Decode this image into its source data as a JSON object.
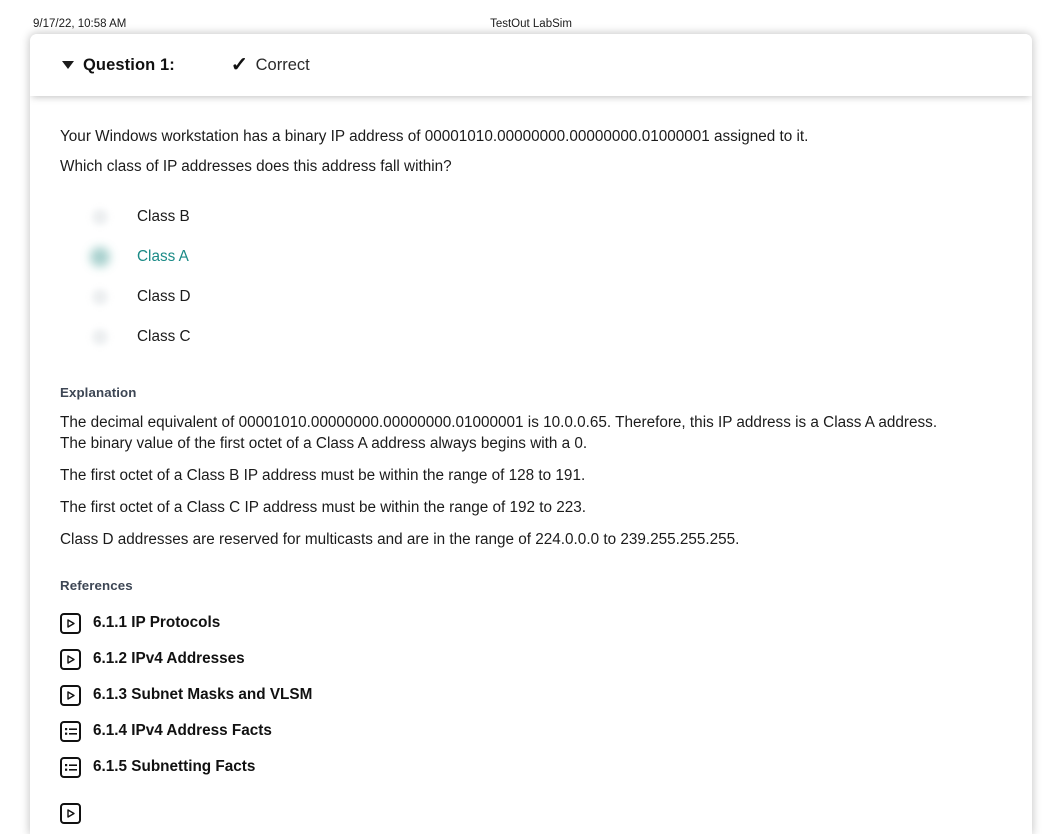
{
  "print_header": {
    "date": "9/17/22, 10:58 AM",
    "title": "TestOut LabSim"
  },
  "question": {
    "caret_icon": "caret-down-icon",
    "label": "Question 1:",
    "status_icon": "check-icon",
    "status_text": "Correct",
    "stem_line_1": "Your Windows workstation has a binary IP address of 00001010.00000000.00000000.01000001 assigned to it.",
    "stem_line_2": "Which class of IP addresses does this address fall within?",
    "options": [
      {
        "label": "Class B",
        "selected": false
      },
      {
        "label": "Class A",
        "selected": true
      },
      {
        "label": "Class D",
        "selected": false
      },
      {
        "label": "Class C",
        "selected": false
      }
    ]
  },
  "explanation": {
    "heading": "Explanation",
    "paragraphs": [
      "The decimal equivalent of 00001010.00000000.00000000.01000001 is 10.0.0.65. Therefore, this IP address is a Class A address. The binary value of the first octet of a Class A address always begins with a 0.",
      "The first octet of a Class B IP address must be within the range of 128 to 191.",
      "The first octet of a Class C IP address must be within the range of 192 to 223.",
      "Class D addresses are reserved for multicasts and are in the range of 224.0.0.0 to 239.255.255.255."
    ]
  },
  "references": {
    "heading": "References",
    "items": [
      {
        "icon": "play-icon",
        "label": "6.1.1 IP Protocols"
      },
      {
        "icon": "play-icon",
        "label": "6.1.2 IPv4 Addresses"
      },
      {
        "icon": "play-icon",
        "label": "6.1.3 Subnet Masks and VLSM"
      },
      {
        "icon": "list-icon",
        "label": "6.1.4 IPv4 Address Facts"
      },
      {
        "icon": "list-icon",
        "label": "6.1.5 Subnetting Facts"
      },
      {
        "icon": "play-icon",
        "label": ""
      }
    ]
  },
  "colors": {
    "correct_answer": "#1a8a86",
    "section_heading": "#3d4654",
    "text": "#1b1b1b"
  }
}
